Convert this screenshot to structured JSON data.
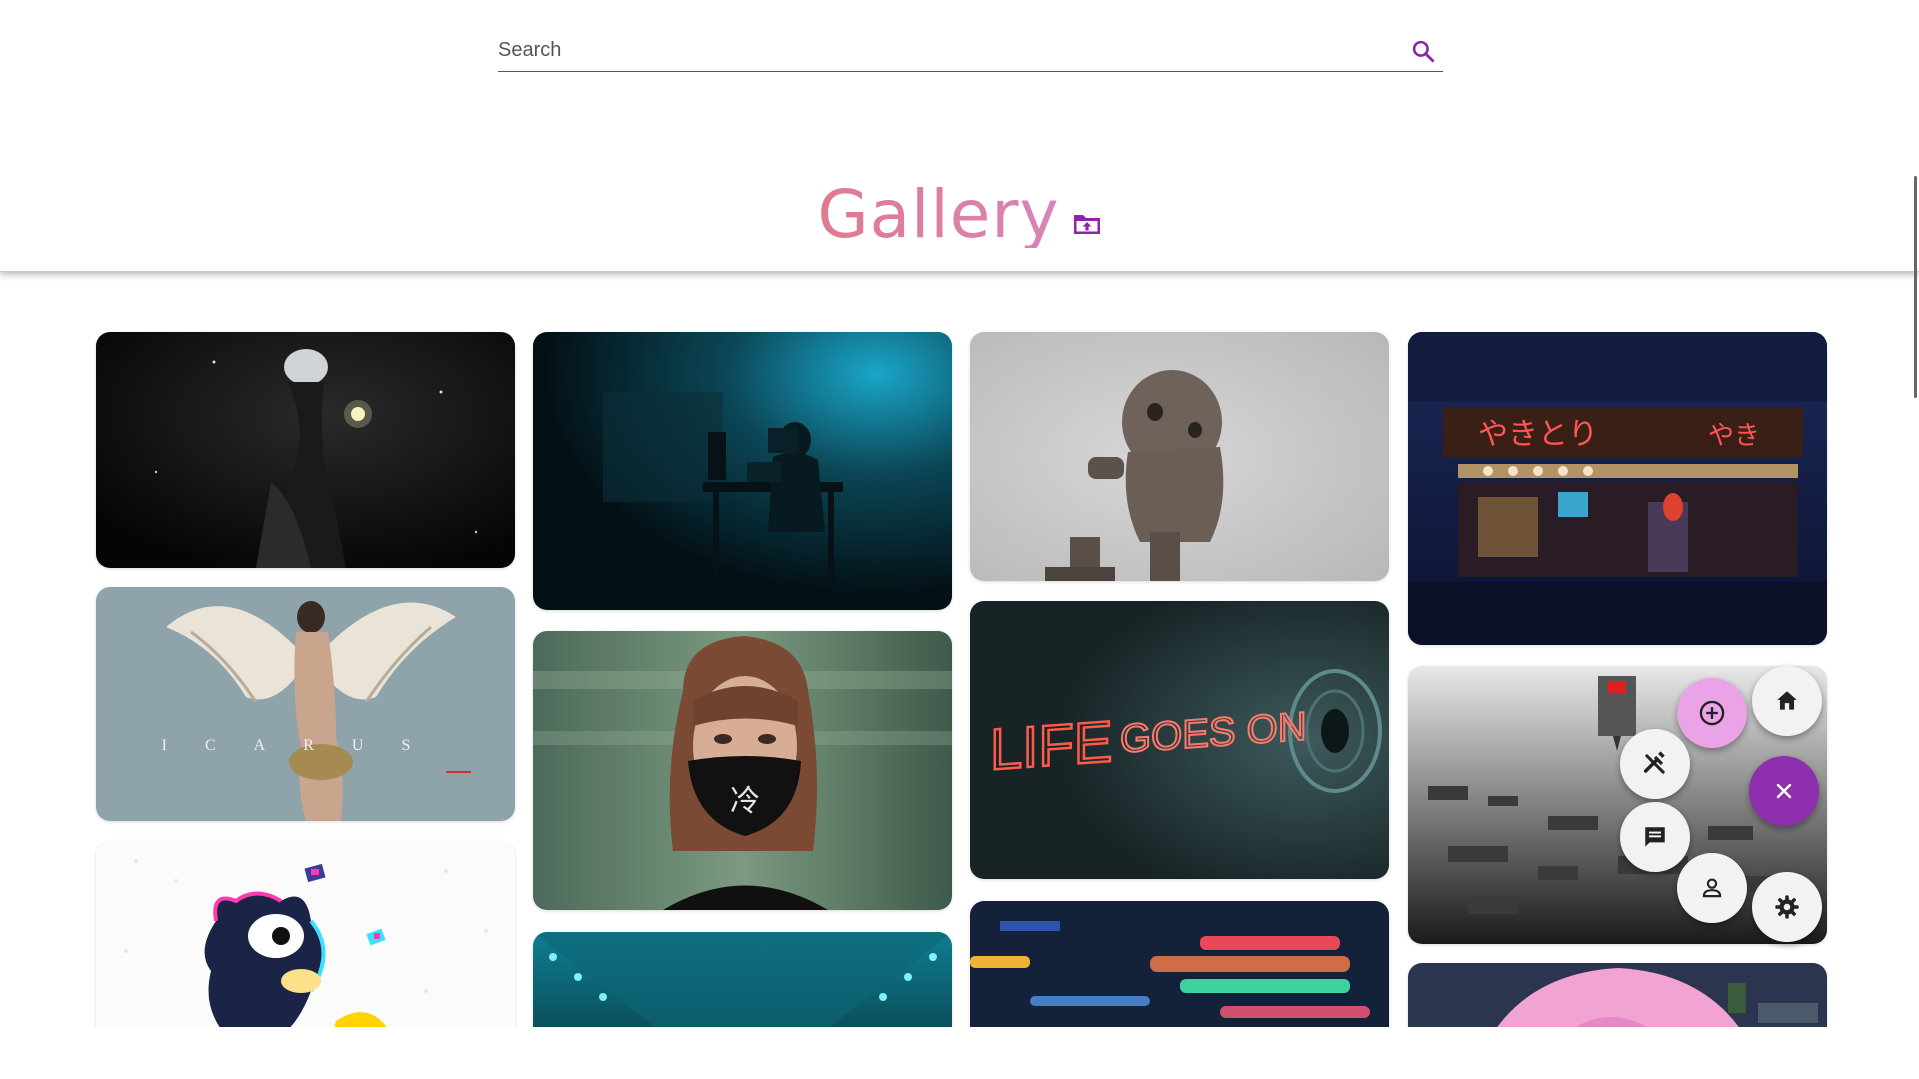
{
  "search": {
    "placeholder": "Search",
    "icon": "search-icon"
  },
  "header": {
    "title": "Gallery",
    "upload_icon": "folder-upload-icon"
  },
  "colors": {
    "accent": "#8e24aa",
    "title_gradient": [
      "#e07a8e",
      "#d884b8"
    ],
    "fab_main": "#8e2fae",
    "fab_add": "#e9a3e6"
  },
  "gallery": {
    "images": [
      {
        "name": "android-girl-glowing-flower"
      },
      {
        "name": "angel-wings-icarus",
        "caption": "I C A R U S"
      },
      {
        "name": "cartoon-cat-glitch"
      },
      {
        "name": "hooded-figure-desk-blue"
      },
      {
        "name": "girl-black-mask"
      },
      {
        "name": "tunnel-blue-lights"
      },
      {
        "name": "small-robot"
      },
      {
        "name": "life-goes-on-neon",
        "caption": "LIFE GOES ON"
      },
      {
        "name": "blurred-city-lights"
      },
      {
        "name": "japanese-izakaya-night"
      },
      {
        "name": "circuit-board-machine"
      },
      {
        "name": "anime-pink-hair"
      }
    ]
  },
  "speed_dial": {
    "actions": [
      {
        "icon": "add-circle-icon",
        "label": "add"
      },
      {
        "icon": "home-icon",
        "label": "home"
      },
      {
        "icon": "tools-icon",
        "label": "tools"
      },
      {
        "icon": "close-icon",
        "label": "close"
      },
      {
        "icon": "chat-icon",
        "label": "chat"
      },
      {
        "icon": "person-icon",
        "label": "profile"
      },
      {
        "icon": "settings-icon",
        "label": "settings"
      }
    ]
  }
}
